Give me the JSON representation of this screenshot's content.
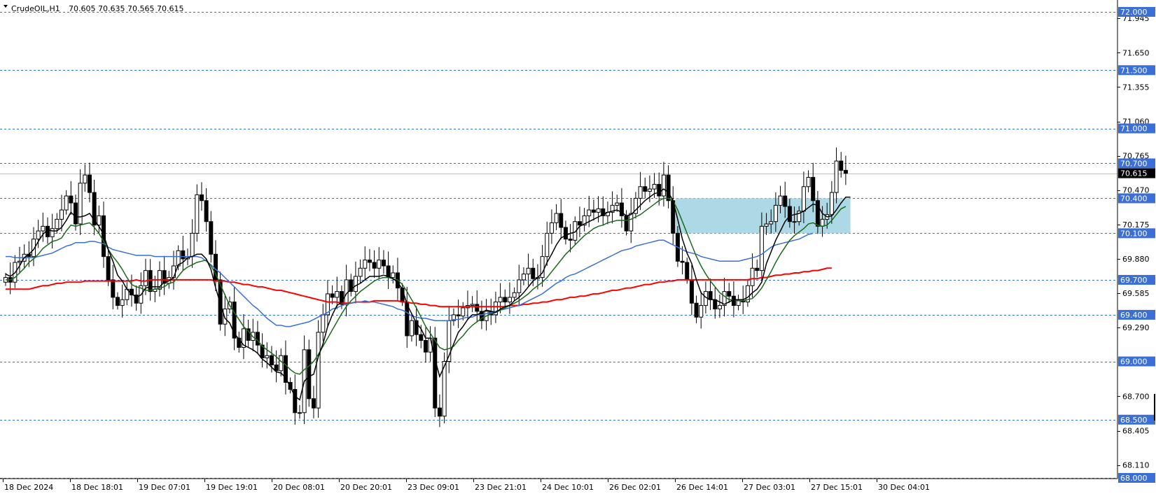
{
  "header": {
    "symbol": "CrudeOIL,H1",
    "ohlc": "70.605 70.635 70.565 70.615"
  },
  "colors": {
    "bull": "#ffffff",
    "bear": "#000000",
    "ma_fast": "#000000",
    "ma_mid": "#1a6a1a",
    "ma_slow": "#3a6fd8",
    "ma_long": "#ff0000",
    "level_line": "#3a6fd8",
    "level_label_bg": "#3a6fd8",
    "price_label_bg": "#000000",
    "zone": "#add8e6"
  },
  "chart_data": {
    "type": "candlestick",
    "timeframe": "H1",
    "ylim": [
      68.0,
      72.0
    ],
    "y_ticks": [
      "71.945",
      "71.650",
      "71.355",
      "71.060",
      "70.765",
      "70.470",
      "70.175",
      "69.880",
      "69.585",
      "69.290",
      "68.700",
      "68.405",
      "68.110"
    ],
    "x_ticks": [
      "18 Dec 2024",
      "18 Dec 18:01",
      "19 Dec 07:01",
      "19 Dec 19:01",
      "20 Dec 08:01",
      "20 Dec 20:01",
      "23 Dec 09:01",
      "23 Dec 21:01",
      "24 Dec 10:01",
      "26 Dec 02:01",
      "26 Dec 14:01",
      "27 Dec 03:01",
      "27 Dec 15:01",
      "30 Dec 04:01"
    ],
    "levels": [
      {
        "value": 72.0,
        "label": "72.000"
      },
      {
        "value": 71.5,
        "label": "71.500"
      },
      {
        "value": 71.0,
        "label": "71.000"
      },
      {
        "value": 70.7,
        "label": "70.700"
      },
      {
        "value": 70.4,
        "label": "70.400"
      },
      {
        "value": 70.1,
        "label": "70.100"
      },
      {
        "value": 69.7,
        "label": "69.700"
      },
      {
        "value": 69.4,
        "label": "69.400"
      },
      {
        "value": 69.0,
        "label": "69.000"
      },
      {
        "value": 68.5,
        "label": "68.500"
      },
      {
        "value": 68.0,
        "label": "68.000"
      }
    ],
    "current_price": {
      "value": 70.615,
      "label": "70.615"
    },
    "zone": {
      "from": 70.1,
      "to": 70.4,
      "start_index": 144,
      "end_index": 181
    },
    "close": [
      69.72,
      69.68,
      69.85,
      69.86,
      69.92,
      69.9,
      70.05,
      70.12,
      70.16,
      70.07,
      70.14,
      70.22,
      70.3,
      70.42,
      70.36,
      70.18,
      70.53,
      70.6,
      70.45,
      70.17,
      70.25,
      69.9,
      69.7,
      69.55,
      69.48,
      69.53,
      69.62,
      69.57,
      69.5,
      69.65,
      69.78,
      69.6,
      69.62,
      69.78,
      69.67,
      69.72,
      69.82,
      69.95,
      69.88,
      69.9,
      70.1,
      70.43,
      70.38,
      70.2,
      69.92,
      69.7,
      69.32,
      69.45,
      69.51,
      69.2,
      69.12,
      69.28,
      69.18,
      69.25,
      69.14,
      69.03,
      69.05,
      68.97,
      68.92,
      69.05,
      68.82,
      68.76,
      68.56,
      68.56,
      69.1,
      68.68,
      68.6,
      69.25,
      69.4,
      69.58,
      69.55,
      69.6,
      69.49,
      69.7,
      69.6,
      69.73,
      69.8,
      69.87,
      69.85,
      69.8,
      69.87,
      69.82,
      69.72,
      69.76,
      69.63,
      69.51,
      69.22,
      69.35,
      69.23,
      69.18,
      69.08,
      69.2,
      68.6,
      68.53,
      69.0,
      69.35,
      69.4,
      69.39,
      69.46,
      69.48,
      69.49,
      69.43,
      69.35,
      69.43,
      69.4,
      69.51,
      69.55,
      69.51,
      69.55,
      69.59,
      69.7,
      69.75,
      69.8,
      69.71,
      69.72,
      69.9,
      70.1,
      70.19,
      70.27,
      70.15,
      70.05,
      70.04,
      70.2,
      70.17,
      70.25,
      70.3,
      70.28,
      70.31,
      70.25,
      70.28,
      70.34,
      70.36,
      70.25,
      70.12,
      70.27,
      70.4,
      70.5,
      70.46,
      70.48,
      70.52,
      70.42,
      70.6,
      70.38,
      70.1,
      69.86,
      69.85,
      69.7,
      69.5,
      69.38,
      69.48,
      69.6,
      69.53,
      69.45,
      69.48,
      69.6,
      69.56,
      69.48,
      69.52,
      69.51,
      69.65,
      69.8,
      69.78,
      70.16,
      70.18,
      70.2,
      70.34,
      70.42,
      70.33,
      70.2,
      70.2,
      70.29,
      70.5,
      70.58,
      70.38,
      70.16,
      70.22,
      70.26,
      70.45,
      70.72,
      70.64,
      70.615
    ],
    "ma_fast_values": [
      69.75,
      69.73,
      69.76,
      69.82,
      69.89,
      69.92,
      69.96,
      70.03,
      70.09,
      70.13,
      70.12,
      70.12,
      70.15,
      70.21,
      70.28,
      70.24,
      70.24,
      70.25,
      70.27,
      70.21,
      70.16,
      70.09,
      69.96,
      69.86,
      69.74,
      69.69,
      69.62,
      69.58,
      69.55,
      69.57,
      69.63,
      69.64,
      69.64,
      69.64,
      69.68,
      69.69,
      69.72,
      69.83,
      69.85,
      69.89,
      69.9,
      69.92,
      69.92,
      69.88,
      69.79,
      69.63,
      69.5,
      69.37,
      69.33,
      69.24,
      69.19,
      69.14,
      69.12,
      69.1,
      69.07,
      69.02,
      68.99,
      68.95,
      68.91,
      68.9,
      68.86,
      68.78,
      68.7,
      68.67,
      68.83,
      68.87,
      68.89,
      69.04,
      69.15,
      69.3,
      69.4,
      69.48,
      69.51,
      69.58,
      69.62,
      69.65,
      69.67,
      69.7,
      69.73,
      69.73,
      69.73,
      69.74,
      69.73,
      69.71,
      69.68,
      69.62,
      69.49,
      69.41,
      69.33,
      69.28,
      69.2,
      69.2,
      69.02,
      68.87,
      68.96,
      69.05,
      69.15,
      69.25,
      69.3,
      69.36,
      69.4,
      69.4,
      69.42,
      69.44,
      69.43,
      69.42,
      69.45,
      69.47,
      69.48,
      69.52,
      69.55,
      69.59,
      69.64,
      69.69,
      69.72,
      69.76,
      69.85,
      69.92,
      70.0,
      70.06,
      70.08,
      70.1,
      70.11,
      70.16,
      70.18,
      70.2,
      70.22,
      70.24,
      70.26,
      70.28,
      70.29,
      70.3,
      70.28,
      70.25,
      70.26,
      70.3,
      70.34,
      70.38,
      70.41,
      70.44,
      70.45,
      70.48,
      70.45,
      70.38,
      70.22,
      70.05,
      69.93,
      69.84,
      69.7,
      69.59,
      69.55,
      69.53,
      69.53,
      69.51,
      69.49,
      69.51,
      69.53,
      69.53,
      69.53,
      69.55,
      69.59,
      69.62,
      69.68,
      69.84,
      69.94,
      70.04,
      70.12,
      70.2,
      70.25,
      70.26,
      70.27,
      70.29,
      70.32,
      70.35,
      70.34,
      70.27,
      70.24,
      70.25,
      70.3,
      70.36,
      70.41,
      70.41
    ],
    "ma_mid_values": [
      69.7,
      69.7,
      69.72,
      69.76,
      69.8,
      69.85,
      69.88,
      69.92,
      69.97,
      70.0,
      70.03,
      70.04,
      70.06,
      70.12,
      70.17,
      70.16,
      70.17,
      70.18,
      70.19,
      70.15,
      70.1,
      70.03,
      69.96,
      69.9,
      69.85,
      69.79,
      69.72,
      69.66,
      69.64,
      69.63,
      69.61,
      69.61,
      69.62,
      69.63,
      69.64,
      69.67,
      69.68,
      69.73,
      69.78,
      69.81,
      69.83,
      69.85,
      69.86,
      69.87,
      69.82,
      69.75,
      69.66,
      69.57,
      69.48,
      69.42,
      69.36,
      69.3,
      69.26,
      69.21,
      69.18,
      69.13,
      69.1,
      69.07,
      69.04,
      69.0,
      68.97,
      68.93,
      68.9,
      68.89,
      68.93,
      68.96,
      69.0,
      69.06,
      69.13,
      69.2,
      69.27,
      69.34,
      69.41,
      69.47,
      69.52,
      69.56,
      69.6,
      69.63,
      69.66,
      69.69,
      69.71,
      69.72,
      69.72,
      69.71,
      69.7,
      69.66,
      69.6,
      69.53,
      69.46,
      69.38,
      69.3,
      69.24,
      69.18,
      69.12,
      69.1,
      69.11,
      69.13,
      69.18,
      69.22,
      69.27,
      69.31,
      69.34,
      69.37,
      69.39,
      69.41,
      69.42,
      69.44,
      69.46,
      69.48,
      69.5,
      69.52,
      69.55,
      69.58,
      69.62,
      69.65,
      69.68,
      69.72,
      69.77,
      69.82,
      69.87,
      69.92,
      69.96,
      70.0,
      70.04,
      70.08,
      70.11,
      70.14,
      70.16,
      70.17,
      70.19,
      70.2,
      70.21,
      70.21,
      70.21,
      70.22,
      70.24,
      70.26,
      70.29,
      70.32,
      70.35,
      70.38,
      70.4,
      70.4,
      70.38,
      70.3,
      70.2,
      70.1,
      70.0,
      69.9,
      69.82,
      69.75,
      69.69,
      69.64,
      69.59,
      69.56,
      69.53,
      69.53,
      69.52,
      69.52,
      69.53,
      69.54,
      69.58,
      69.63,
      69.7,
      69.77,
      69.85,
      69.92,
      69.98,
      70.04,
      70.08,
      70.11,
      70.14,
      70.18,
      70.19,
      70.17,
      70.16,
      70.17,
      70.21,
      70.26,
      70.31,
      70.33
    ],
    "ma_slow_values": [
      69.9,
      69.9,
      69.89,
      69.89,
      69.89,
      69.89,
      69.89,
      69.9,
      69.91,
      69.92,
      69.93,
      69.95,
      69.97,
      69.99,
      70.0,
      70.02,
      70.02,
      70.02,
      70.03,
      70.03,
      70.02,
      70.01,
      69.98,
      69.96,
      69.95,
      69.94,
      69.93,
      69.92,
      69.91,
      69.91,
      69.91,
      69.91,
      69.9,
      69.9,
      69.9,
      69.9,
      69.9,
      69.9,
      69.9,
      69.9,
      69.9,
      69.9,
      69.89,
      69.86,
      69.83,
      69.79,
      69.76,
      69.72,
      69.68,
      69.64,
      69.6,
      69.56,
      69.52,
      69.48,
      69.45,
      69.41,
      69.37,
      69.34,
      69.31,
      69.31,
      69.3,
      69.3,
      69.31,
      69.32,
      69.33,
      69.34,
      69.36,
      69.38,
      69.4,
      69.42,
      69.45,
      69.46,
      69.48,
      69.49,
      69.5,
      69.51,
      69.51,
      69.52,
      69.51,
      69.51,
      69.5,
      69.49,
      69.48,
      69.47,
      69.45,
      69.44,
      69.42,
      69.39,
      69.38,
      69.37,
      69.37,
      69.36,
      69.35,
      69.35,
      69.35,
      69.35,
      69.36,
      69.36,
      69.37,
      69.38,
      69.38,
      69.4,
      69.4,
      69.41,
      69.42,
      69.43,
      69.44,
      69.45,
      69.46,
      69.47,
      69.48,
      69.5,
      69.52,
      69.54,
      69.56,
      69.58,
      69.61,
      69.64,
      69.67,
      69.69,
      69.72,
      69.74,
      69.75,
      69.77,
      69.79,
      69.81,
      69.83,
      69.85,
      69.87,
      69.89,
      69.91,
      69.93,
      69.95,
      69.96,
      69.97,
      69.99,
      70.0,
      70.01,
      70.02,
      70.03,
      70.04,
      70.04,
      70.02,
      70.0,
      69.98,
      69.96,
      69.94,
      69.93,
      69.92,
      69.9,
      69.89,
      69.88,
      69.87,
      69.86,
      69.86,
      69.86,
      69.86,
      69.86,
      69.87,
      69.88,
      69.89,
      69.9,
      69.92,
      69.95,
      69.98,
      70.0,
      70.01,
      70.02,
      70.03,
      70.04,
      70.05,
      70.07,
      70.09,
      70.1
    ],
    "ma_long_values": [
      69.62,
      69.62,
      69.62,
      69.62,
      69.62,
      69.62,
      69.63,
      69.64,
      69.65,
      69.65,
      69.66,
      69.67,
      69.67,
      69.68,
      69.68,
      69.68,
      69.68,
      69.69,
      69.69,
      69.69,
      69.69,
      69.69,
      69.69,
      69.69,
      69.69,
      69.69,
      69.69,
      69.69,
      69.7,
      69.69,
      69.69,
      69.7,
      69.7,
      69.7,
      69.7,
      69.7,
      69.7,
      69.7,
      69.7,
      69.7,
      69.7,
      69.7,
      69.7,
      69.7,
      69.7,
      69.69,
      69.69,
      69.69,
      69.68,
      69.68,
      69.67,
      69.66,
      69.66,
      69.65,
      69.64,
      69.64,
      69.63,
      69.62,
      69.61,
      69.61,
      69.6,
      69.59,
      69.58,
      69.57,
      69.56,
      69.55,
      69.54,
      69.53,
      69.52,
      69.51,
      69.51,
      69.51,
      69.5,
      69.5,
      69.5,
      69.51,
      69.51,
      69.51,
      69.51,
      69.52,
      69.52,
      69.52,
      69.52,
      69.52,
      69.52,
      69.51,
      69.51,
      69.5,
      69.5,
      69.49,
      69.49,
      69.48,
      69.48,
      69.47,
      69.47,
      69.47,
      69.47,
      69.47,
      69.47,
      69.47,
      69.47,
      69.47,
      69.47,
      69.47,
      69.47,
      69.47,
      69.47,
      69.47,
      69.48,
      69.48,
      69.48,
      69.49,
      69.49,
      69.5,
      69.5,
      69.51,
      69.51,
      69.52,
      69.53,
      69.53,
      69.54,
      69.55,
      69.55,
      69.56,
      69.56,
      69.57,
      69.58,
      69.58,
      69.59,
      69.6,
      69.61,
      69.61,
      69.62,
      69.63,
      69.63,
      69.64,
      69.65,
      69.66,
      69.66,
      69.67,
      69.68,
      69.68,
      69.69,
      69.69,
      69.7,
      69.7,
      69.7,
      69.7,
      69.7,
      69.7,
      69.7,
      69.7,
      69.7,
      69.7,
      69.7,
      69.7,
      69.7,
      69.7,
      69.7,
      69.7,
      69.71,
      69.71,
      69.72,
      69.72,
      69.73,
      69.74,
      69.74,
      69.75,
      69.75,
      69.76,
      69.76,
      69.77,
      69.77,
      69.78,
      69.78,
      69.79,
      69.8,
      69.8
    ]
  }
}
